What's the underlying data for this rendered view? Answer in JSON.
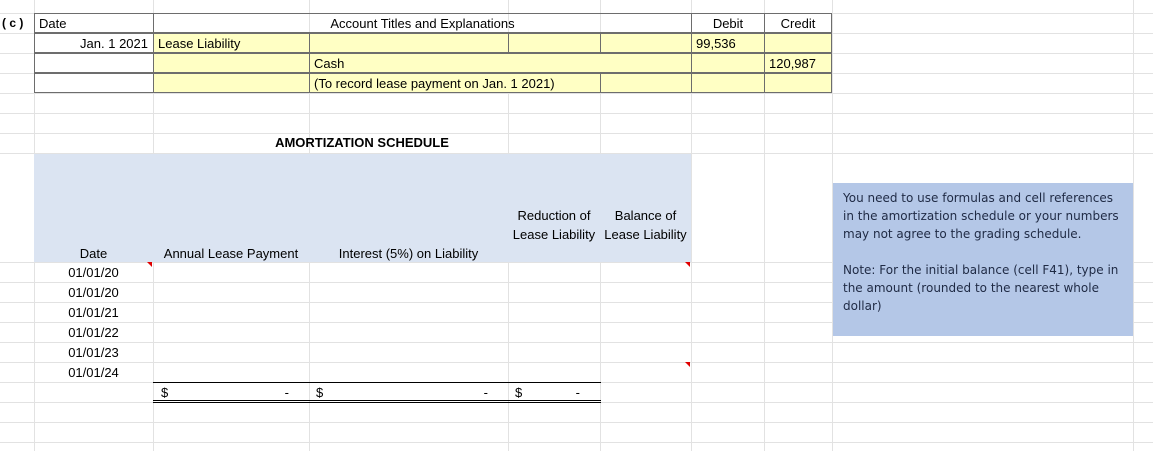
{
  "part_label": "( c )",
  "journal": {
    "headers": {
      "date": "Date",
      "account": "Account Titles and Explanations",
      "debit": "Debit",
      "credit": "Credit"
    },
    "rows": [
      {
        "date": "Jan. 1 2021",
        "account": "Lease Liability",
        "explanation": "",
        "debit": "99,536",
        "credit": ""
      },
      {
        "date": "",
        "account": "",
        "explanation": "Cash",
        "debit": "",
        "credit": "120,987"
      },
      {
        "date": "",
        "account": "",
        "explanation": "(To record lease payment on Jan. 1 2021)",
        "debit": "",
        "credit": ""
      }
    ]
  },
  "schedule": {
    "title": "AMORTIZATION SCHEDULE",
    "headers": {
      "date": "Date",
      "payment": "Annual Lease Payment",
      "interest": "Interest (5%) on Liability",
      "reduction": "Reduction of Lease Liability",
      "balance": "Balance of Lease Liability"
    },
    "dates": [
      "01/01/20",
      "01/01/20",
      "01/01/21",
      "01/01/22",
      "01/01/23",
      "01/01/24"
    ],
    "totals": {
      "currency": "$",
      "payment": "-",
      "interest": "-",
      "reduction": "-"
    }
  },
  "note": {
    "paragraph1": "You need to use formulas and cell references in the amortization schedule or your numbers may not agree to the grading schedule.",
    "paragraph2": "Note: For the initial balance (cell F41), type in the amount (rounded to the nearest whole dollar)"
  },
  "colors": {
    "input_fill": "#ffffc4",
    "header_fill": "#dbe4f2",
    "note_fill": "#b4c7e7",
    "comment_marker": "#e00000"
  }
}
